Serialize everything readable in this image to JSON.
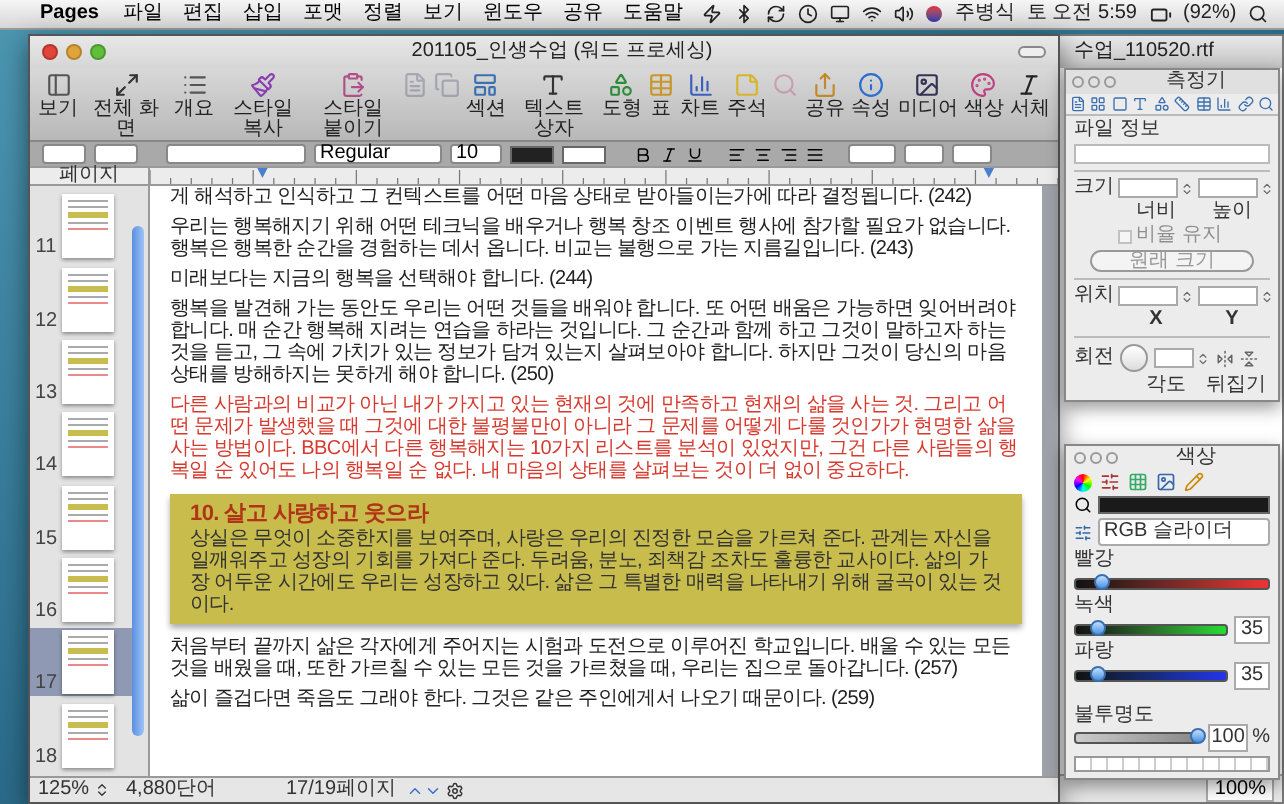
{
  "menu_bar": {
    "app": "Pages",
    "items": [
      "파일",
      "편집",
      "삽입",
      "포맷",
      "정렬",
      "보기",
      "윈도우",
      "공유",
      "도움말"
    ],
    "user": "주병식",
    "clock": "토 오전 5:59",
    "battery": "(92%)"
  },
  "back_window": {
    "title": "수업_110520.rtf",
    "zoom": "100%"
  },
  "main_window": {
    "title": "201105_인생수업 (워드 프로세싱)",
    "toolbar": [
      {
        "label": "보기",
        "disabled": false
      },
      {
        "label": "전체 화면",
        "disabled": false
      },
      {
        "label": "개요",
        "disabled": false
      },
      {
        "label": "스타일 복사",
        "disabled": false
      },
      {
        "label": "스타일 붙이기",
        "disabled": false
      },
      {
        "disabled": true
      },
      {
        "disabled": true
      },
      {
        "label": "섹션",
        "disabled": false
      },
      {
        "label": "텍스트 상자",
        "disabled": false
      },
      {
        "label": "도형",
        "disabled": false
      },
      {
        "label": "표",
        "disabled": false
      },
      {
        "label": "차트",
        "disabled": false
      },
      {
        "label": "주석",
        "disabled": false
      },
      {
        "disabled": true
      },
      {
        "label": "공유",
        "disabled": false
      },
      {
        "label": "속성",
        "disabled": false
      },
      {
        "label": "미디어",
        "disabled": false
      },
      {
        "label": "색상",
        "disabled": false
      },
      {
        "label": "서체",
        "disabled": false
      }
    ],
    "format_bar": {
      "style": "Regular",
      "size": "10"
    },
    "sidebar": {
      "title": "페이지",
      "pages": [
        {
          "number": "11",
          "selected": false
        },
        {
          "number": "12",
          "selected": false
        },
        {
          "number": "13",
          "selected": false
        },
        {
          "number": "14",
          "selected": false
        },
        {
          "number": "15",
          "selected": false
        },
        {
          "number": "16",
          "selected": false
        },
        {
          "number": "17",
          "selected": true
        },
        {
          "number": "18",
          "selected": false
        }
      ]
    },
    "document": [
      {
        "kind": "body",
        "text": "게 해석하고 인식하고 그 컨텍스트를 어떤 마음 상태로 받아들이는가에 따라 결정됩니다. (242)"
      },
      {
        "kind": "body",
        "text": "우리는 행복해지기 위해 어떤 테크닉을 배우거나 행복 창조 이벤트 행사에 참가할 필요가 없습니다. 행복은 행복한 순간을 경험하는 데서 옵니다. 비교는 불행으로 가는 지름길입니다. (243)"
      },
      {
        "kind": "body",
        "text": "미래보다는 지금의 행복을 선택해야 합니다. (244)"
      },
      {
        "kind": "body",
        "text": "행복을 발견해 가는 동안도 우리는 어떤 것들을 배워야 합니다. 또 어떤 배움은 가능하면 잊어버려야 합니다. 매 순간 행복해 지려는 연습을 하라는 것입니다. 그 순간과 함께 하고 그것이 말하고자 하는 것을 듣고, 그 속에 가치가 있는 정보가 담겨 있는지 살펴보아야 합니다. 하지만 그것이 당신의 마음 상태를 방해하지는 못하게 해야 합니다. (250)"
      },
      {
        "kind": "highlight",
        "text": "다른 사람과의 비교가 아닌 내가 가지고 있는 현재의 것에 만족하고 현재의 삶을 사는 것. 그리고 어떤 문제가 발생했을 때 그것에 대한 불평불만이 아니라 그 문제를 어떻게 다룰 것인가가 현명한 삶을 사는 방법이다. BBC에서 다른 행복해지는 10가지 리스트를 분석이 있었지만, 그건 다른 사람들의 행복일 순 있어도 나의 행복일 순 없다. 내 마음의 상태를 살펴보는 것이 더 없이 중요하다."
      },
      {
        "kind": "callout",
        "title": "10. 살고 사랑하고 웃으라",
        "text": "상실은 무엇이 소중한지를 보여주며, 사랑은 우리의 진정한 모습을 가르쳐 준다. 관계는 자신을 일깨워주고 성장의 기회를 가져다 준다. 두려움, 분노, 죄책감 조차도 훌륭한 교사이다. 삶의 가장 어두운 시간에도 우리는 성장하고 있다. 삶은 그 특별한 매력을 나타내기 위해 굴곡이 있는 것이다."
      },
      {
        "kind": "body",
        "text": "처음부터 끝까지 삶은 각자에게 주어지는 시험과 도전으로 이루어진 학교입니다. 배울 수 있는 모든 것을 배웠을 때, 또한 가르칠 수 있는 모든 것을 가르쳤을 때, 우리는 집으로 돌아갑니다. (257)"
      },
      {
        "kind": "body",
        "text": "삶이 즐겁다면 죽음도 그래야 한다. 그것은 같은 주인에게서 나오기 때문이다. (259)"
      }
    ],
    "status_bar": {
      "zoom": "125%",
      "words": "4,880단어",
      "pages": "17/19페이지"
    }
  },
  "inspector": {
    "title": "측정기",
    "file_info": "파일 정보",
    "size": "크기",
    "width": "너비",
    "height": "높이",
    "keep_ratio": {
      "label": "비율 유지",
      "checked": false,
      "disabled": true
    },
    "original_size": {
      "label": "원래 크기",
      "disabled": true
    },
    "position": "위치",
    "x": "X",
    "y": "Y",
    "rotate": "회전",
    "angle": "각도",
    "flip": "뒤집기"
  },
  "colors_panel": {
    "title": "색상",
    "mode": "RGB 슬라이더",
    "sliders": [
      {
        "label": "빨강",
        "level": 0.14
      },
      {
        "label": "녹색",
        "level": 0.14,
        "reading": "35"
      },
      {
        "label": "파랑",
        "level": 0.14,
        "reading": "35"
      }
    ],
    "opacity": {
      "label": "불투명도",
      "level": 1,
      "reading": "100",
      "unit": "%"
    }
  }
}
